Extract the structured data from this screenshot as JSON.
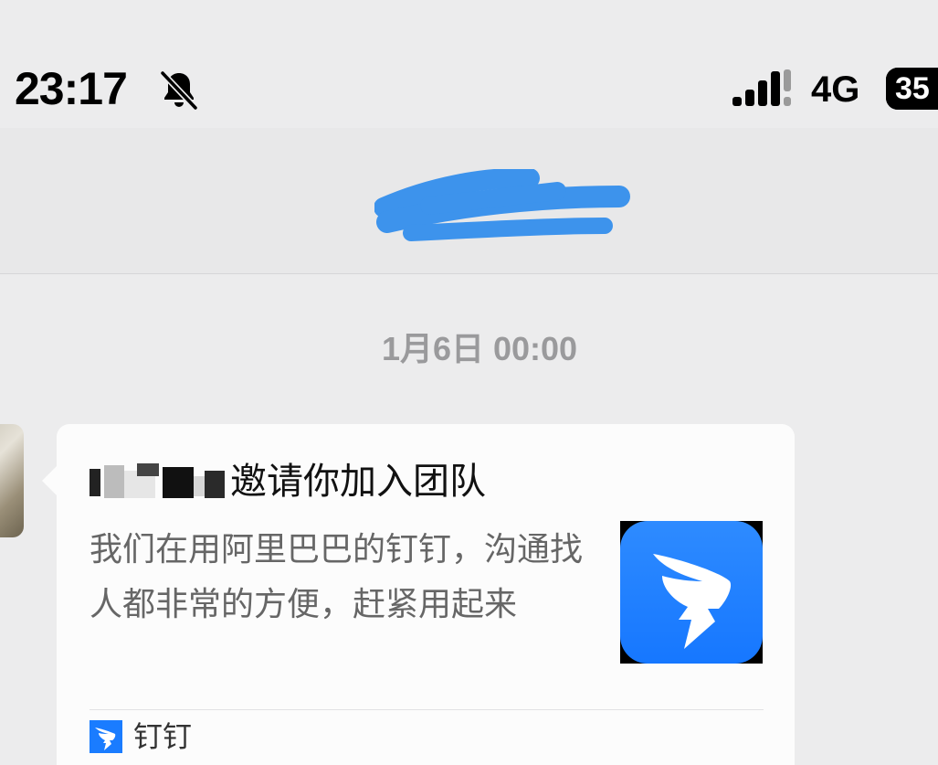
{
  "status_bar": {
    "time": "23:17",
    "mute_icon": "bell-slash-icon",
    "signal_icon": "cellular-signal-icon",
    "network": "4G",
    "battery_text": "35",
    "battery_icon": "battery-icon"
  },
  "header": {
    "title_redacted": true
  },
  "chat": {
    "timestamp": "1月6日 00:00",
    "card": {
      "title_suffix": "邀请你加入团队",
      "description": "我们在用阿里巴巴的钉钉，沟通找人都非常的方便，赶紧用起来",
      "app_icon": "dingtalk-logo-icon",
      "source_icon": "dingtalk-small-icon",
      "source_label": "钉钉",
      "accent_color": "#1677ff"
    }
  }
}
